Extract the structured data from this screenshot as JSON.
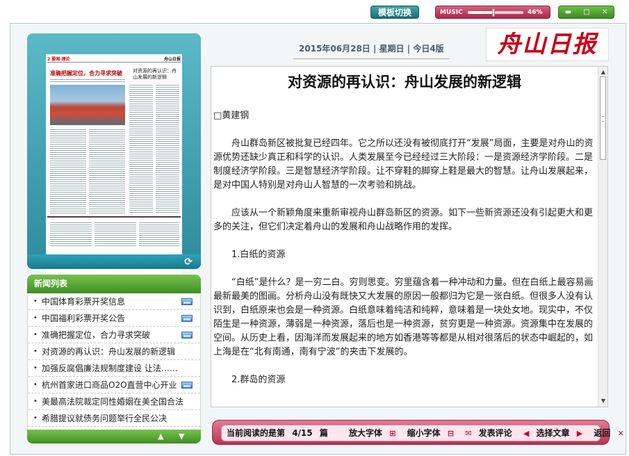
{
  "topbar": {
    "template_switch_label": "模板切换",
    "music_label": "MUSIC",
    "music_volume": "46%",
    "music_volume_fraction": 0.46,
    "win_minimize": "▬",
    "win_maximize": "□",
    "win_close": "✕"
  },
  "preview": {
    "header_left": "2 要闻·理论",
    "header_right": "舟山日报",
    "headline": "准确把握定位，合力寻求突破",
    "side_headline": "对资源的再认识：舟山发展的新逻辑"
  },
  "news": {
    "heading": "新闻列表",
    "items": [
      {
        "text": "中国体育彩票开奖信息",
        "has_pic": true
      },
      {
        "text": "中国福利彩票开奖公告",
        "has_pic": true
      },
      {
        "text": "准确把握定位，合力寻求突破",
        "has_pic": true
      },
      {
        "text": "对资源的再认识：舟山发展的新逻辑",
        "has_pic": false
      },
      {
        "text": "加强反腐倡廉法规制度建设  让法……",
        "has_pic": false
      },
      {
        "text": "杭州首家进口商品O2O直营中心开业",
        "has_pic": true
      },
      {
        "text": "美最高法院裁定同性婚姻在美全国合法",
        "has_pic": false
      },
      {
        "text": "希腊提议就债务问题举行全民公决",
        "has_pic": false
      }
    ]
  },
  "header": {
    "date": "2015年06月28日",
    "weekday": "星期日",
    "edition": "今日4版",
    "logo_text": "舟山日报"
  },
  "article": {
    "title": "对资源的再认识：舟山发展的新逻辑",
    "author": "□黄建钢",
    "paragraphs": [
      {
        "type": "indent",
        "text": "舟山群岛新区被批复已经四年。它之所以还没有被彻底打开“发展”局面，主要是对舟山的资源优势还缺少真正和科学的认识。人类发展至今已经经过三大阶段：一是资源经济学阶段。二是制度经济学阶段。三是智慧经济学阶段。让不穿鞋的脚穿上鞋是最大的智慧。让舟山发展起来，是对中国人特别是对舟山人智慧的一次考验和挑战。"
      },
      {
        "type": "indent",
        "text": "应该从一个新颖角度来重新审视舟山群岛新区的资源。如下一些新资源还没有引起更大和更多的关注，但它们决定着舟山的发展和舟山战略作用的发挥。"
      },
      {
        "type": "section",
        "text": "1.白纸的资源"
      },
      {
        "type": "indent",
        "text": "“白纸”是什么？是一穷二白。穷则思变。穷里蕴含着一种冲动和力量。但在白纸上最容易画最新最美的图画。分析舟山没有既快又大发展的原因一般都归为它是一张白纸。但很多人没有认识到，白纸原来也会是一种资源。白纸意味着纯洁和纯粹，意味着是一块处女地。现实中，不仅陌生是一种资源，薄弱是一种资源，落后也是一种资源，贫穷更是一种资源。资源集中在发展的空间。从历史上看，因海洋而发展起来的地方如香港等等都是从相对很落后的状态中崛起的，如上海是在“北有南通，南有宁波”的夹击下发展的。"
      },
      {
        "type": "section",
        "text": "2.群岛的资源"
      }
    ]
  },
  "toolbar": {
    "reading_prefix": "当前阅读的是第",
    "reading_page": "4/15",
    "reading_suffix": "篇",
    "enlarge": "放大字体",
    "shrink": "缩小字体",
    "comment": "发表评论",
    "select_article": "选择文章",
    "back": "返回"
  }
}
